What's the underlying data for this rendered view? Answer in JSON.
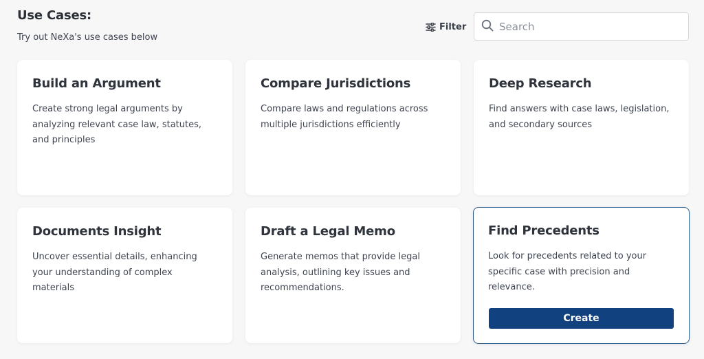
{
  "header": {
    "title": "Use Cases:",
    "subtitle": "Try out NeXa's use cases below"
  },
  "toolbar": {
    "filter_label": "Filter",
    "search_placeholder": "Search"
  },
  "colors": {
    "primary": "#11417f",
    "selected_border": "#2f5d8a"
  },
  "cards": [
    {
      "title": "Build an Argument",
      "description": "Create strong legal arguments by analyzing relevant case law, statutes, and principles"
    },
    {
      "title": "Compare Jurisdictions",
      "description": "Compare laws and regulations across multiple jurisdictions efficiently"
    },
    {
      "title": "Deep Research",
      "description": "Find answers with case laws, legislation, and secondary sources"
    },
    {
      "title": "Documents Insight",
      "description": "Uncover essential details, enhancing your understanding of complex materials"
    },
    {
      "title": "Draft a Legal Memo",
      "description": "Generate memos that provide legal analysis, outlining key issues and recommendations."
    },
    {
      "title": "Find Precedents",
      "description": "Look for precedents related to your specific case with precision and relevance.",
      "selected": true,
      "action_label": "Create"
    }
  ]
}
